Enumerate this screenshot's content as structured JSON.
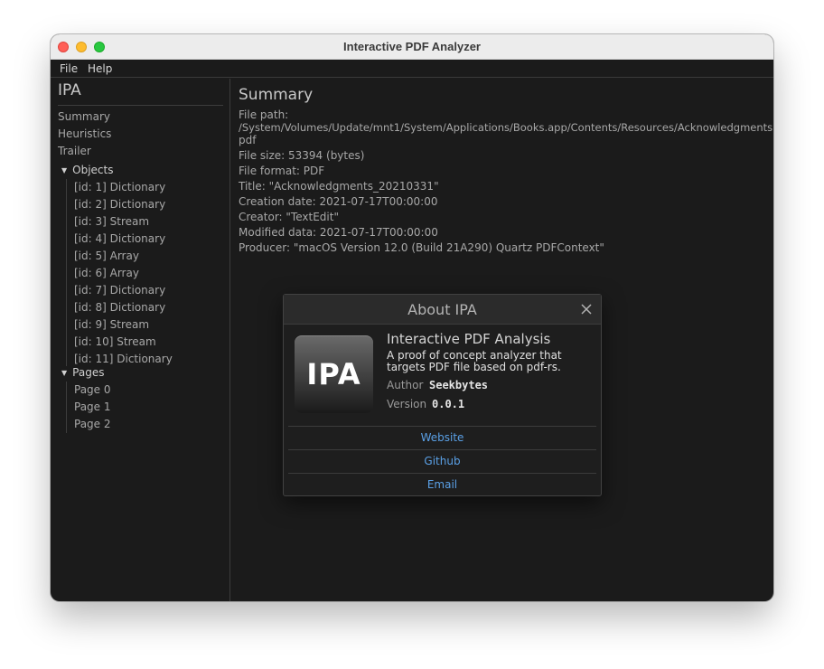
{
  "window": {
    "title": "Interactive PDF Analyzer"
  },
  "menubar": {
    "file": "File",
    "help": "Help"
  },
  "sidebar": {
    "heading": "IPA",
    "links": [
      "Summary",
      "Heuristics",
      "Trailer"
    ],
    "objects": {
      "label": "Objects",
      "items": [
        "[id: 1] Dictionary",
        "[id: 2] Dictionary",
        "[id: 3] Stream",
        "[id: 4] Dictionary",
        "[id: 5] Array",
        "[id: 6] Array",
        "[id: 7] Dictionary",
        "[id: 8] Dictionary",
        "[id: 9] Stream",
        "[id: 10] Stream",
        "[id: 11] Dictionary"
      ]
    },
    "pages": {
      "label": "Pages",
      "items": [
        "Page 0",
        "Page 1",
        "Page 2"
      ]
    }
  },
  "summary": {
    "title": "Summary",
    "file_path_label": "File path:",
    "file_path_line1": "/System/Volumes/Update/mnt1/System/Applications/Books.app/Contents/Resources/Acknowledgments.",
    "file_path_line2": "pdf",
    "file_size": "File size: 53394 (bytes)",
    "file_format": "File format: PDF",
    "title_line": "Title: \"Acknowledgments_20210331\"",
    "creation_date": "Creation date: 2021-07-17T00:00:00",
    "creator": "Creator: \"TextEdit\"",
    "modified_date": "Modified data: 2021-07-17T00:00:00",
    "producer": "Producer: \"macOS Version 12.0 (Build 21A290) Quartz PDFContext\""
  },
  "about": {
    "title": "About IPA",
    "logo_text": "IPA",
    "app_name": "Interactive PDF Analysis",
    "description": "A proof of concept analyzer that targets PDF file based on pdf-rs.",
    "author_label": "Author",
    "author_value": "Seekbytes",
    "version_label": "Version",
    "version_value": "0.0.1",
    "links": [
      "Website",
      "Github",
      "Email"
    ]
  }
}
